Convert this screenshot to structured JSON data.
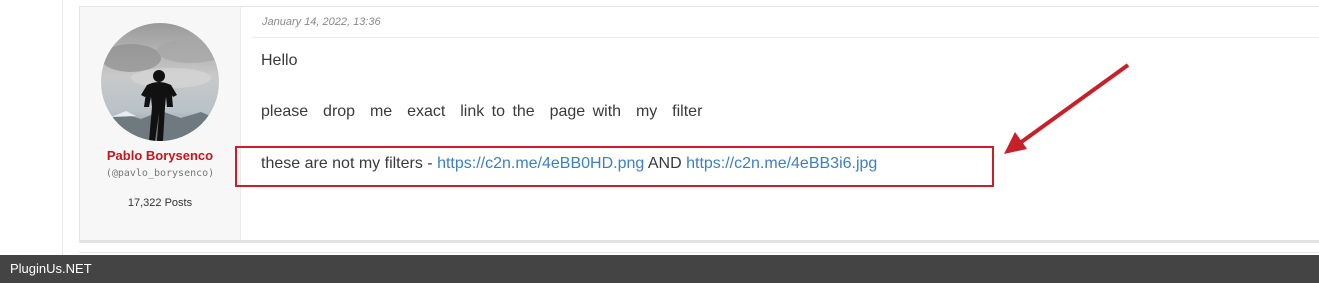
{
  "post": {
    "date": "January 14, 2022, 13:36",
    "author": {
      "name": "Pablo Borysenco",
      "handle": "(@pavlo_borysenco)",
      "posts": "17,322 Posts"
    },
    "body": {
      "line1": "Hello",
      "line2": "please  drop  me  exact  link to the  page with  my  filter",
      "line3_prefix": "these are not my filters - ",
      "link1": "https://c2n.me/4eBB0HD.png",
      "line3_middle": " AND ",
      "link2": "https://c2n.me/4eBB3i6.jpg"
    }
  },
  "footer": {
    "brand": "PluginUs.NET"
  },
  "colors": {
    "author_name": "#c4161c",
    "link": "#3d7fc0",
    "highlight": "#c8202a",
    "footer_bg": "#444444"
  }
}
